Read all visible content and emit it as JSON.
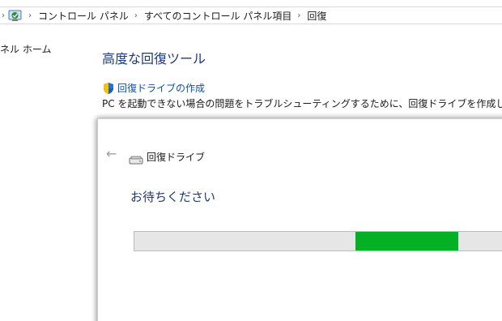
{
  "address_bar": {
    "breadcrumb": [
      "コントロール パネル",
      "すべてのコントロール パネル項目",
      "回復"
    ],
    "left_chevron_icon": "chevron-right",
    "location_icon": "control-panel-icon",
    "separator_icon": "chevron-right"
  },
  "left_pane": {
    "home_link": "ネル ホーム"
  },
  "main": {
    "title": "高度な回復ツール",
    "create_link": "回復ドライブの作成",
    "create_link_icon": "uac-shield-icon",
    "create_description": "PC を起動できない場合の問題をトラブルシューティングするために、回復ドライブを作成します。"
  },
  "wizard": {
    "back_icon": "back-arrow-icon",
    "drive_icon": "drive-icon",
    "title": "回復ドライブ",
    "wait_text": "お待ちください",
    "progress": {
      "mode": "indeterminate",
      "chunk_start_fraction": 0.588,
      "chunk_end_fraction": 0.862,
      "color": "#06b025",
      "track_color": "#e6e6e6"
    }
  },
  "colors": {
    "title_blue": "#1e3a78",
    "link_blue": "#0a50a8"
  }
}
